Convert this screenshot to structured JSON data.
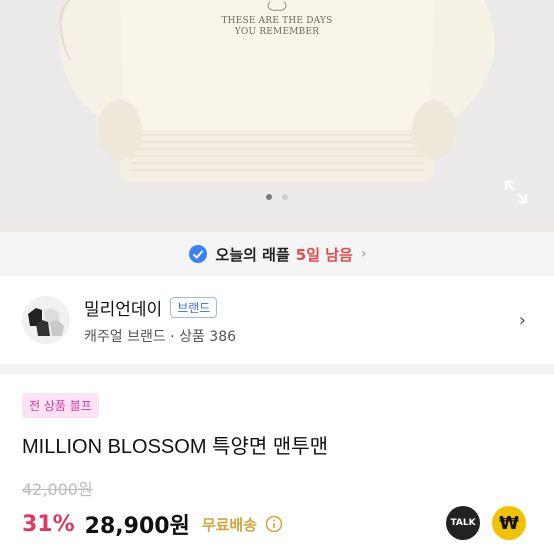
{
  "hero": {
    "print_line1": "THESE ARE THE DAYS",
    "print_line2": "YOU REMEMBER",
    "carousel_dots": 2,
    "active_dot": 0
  },
  "banner": {
    "title": "오늘의 래플",
    "days": "5일 남음"
  },
  "shop": {
    "name": "밀리언데이",
    "badge": "브랜드",
    "meta": "캐주얼 브랜드 · 상품 386"
  },
  "product": {
    "promo": "전 상품 블프",
    "title": "MILLION BLOSSOM 특양면 맨투맨",
    "original_price": "42,000원",
    "discount": "31%",
    "price": "28,900원",
    "shipping": "무료배송"
  },
  "buttons": {
    "talk": "TALK",
    "won": "₩"
  },
  "colors": {
    "accent_red": "#e64a4a",
    "discount_pink": "#e0395f",
    "shipping_gold": "#d1a640",
    "badge_blue": "#3b6fd8"
  }
}
